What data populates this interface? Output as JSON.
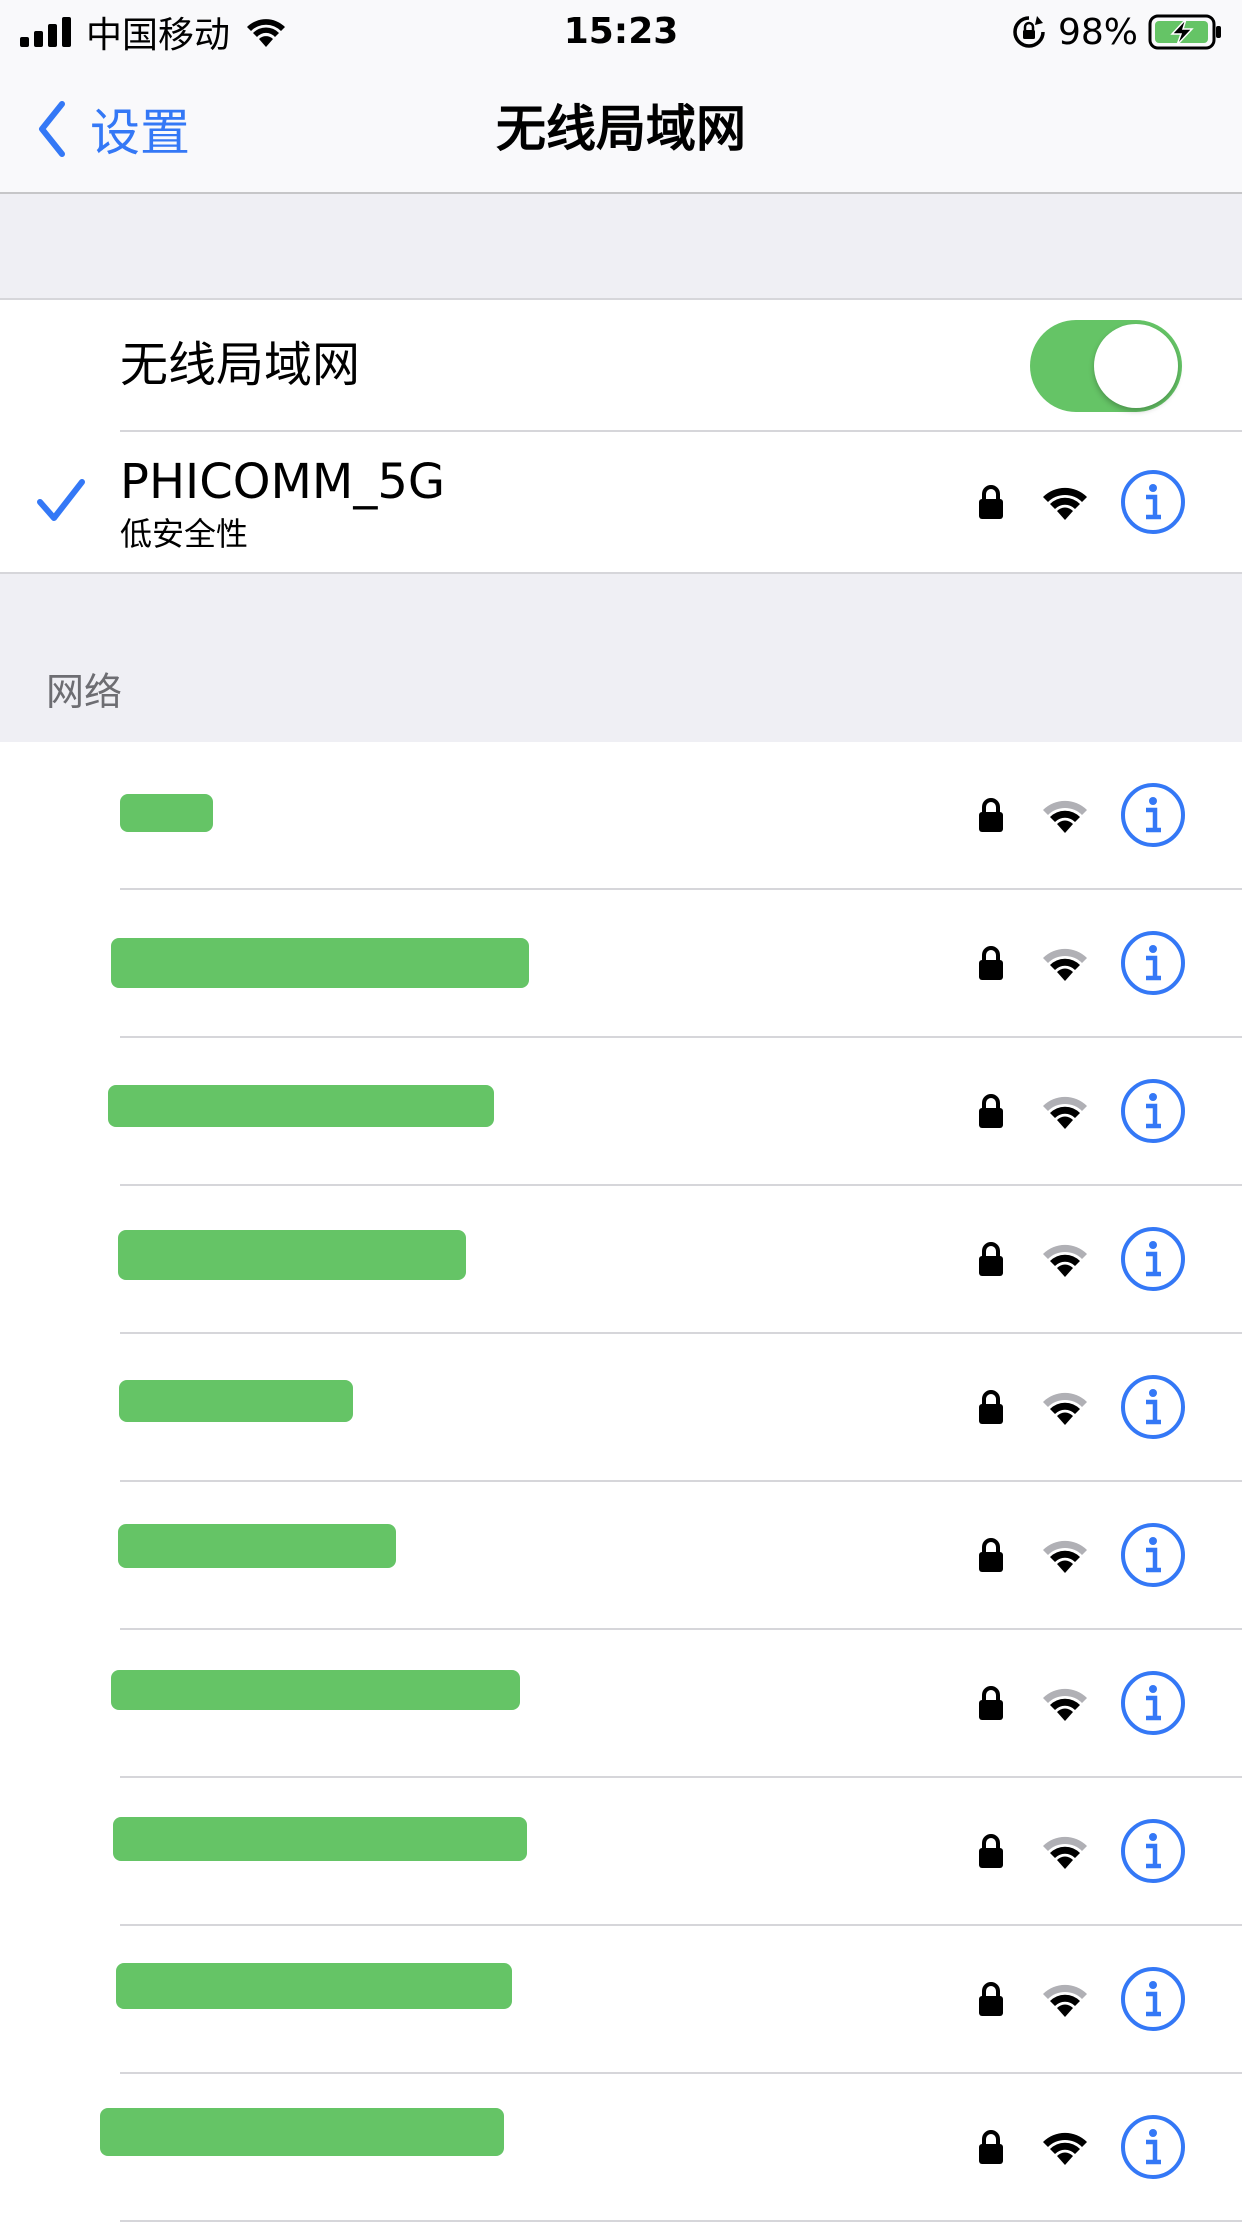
{
  "status_bar": {
    "carrier": "中国移动",
    "time": "15:23",
    "battery_percent": "98%",
    "battery_level": 0.98,
    "icons": [
      "cellular-signal-icon",
      "wifi-icon",
      "rotation-lock-icon",
      "battery-charging-icon"
    ]
  },
  "nav": {
    "back_label": "设置",
    "title": "无线局域网"
  },
  "wifi_toggle": {
    "label": "无线局域网",
    "on": true
  },
  "connected": {
    "name": "PHICOMM_5G",
    "subtitle": "低安全性",
    "secured": true,
    "signal": "full"
  },
  "networks_section": {
    "title": "网络"
  },
  "networks": [
    {
      "name_redacted": true,
      "secured": true,
      "signal": "weak"
    },
    {
      "name_redacted": true,
      "secured": true,
      "signal": "weak"
    },
    {
      "name_redacted": true,
      "secured": true,
      "signal": "weak"
    },
    {
      "name_redacted": true,
      "secured": true,
      "signal": "weak"
    },
    {
      "name_redacted": true,
      "secured": true,
      "signal": "weak"
    },
    {
      "name_redacted": true,
      "secured": true,
      "signal": "weak"
    },
    {
      "name_redacted": true,
      "secured": true,
      "signal": "weak"
    },
    {
      "name_redacted": true,
      "secured": true,
      "signal": "weak"
    },
    {
      "name_redacted": true,
      "secured": true,
      "signal": "weak"
    },
    {
      "name_redacted": true,
      "secured": true,
      "signal": "full"
    }
  ],
  "colors": {
    "accent": "#3478f6",
    "toggle_on": "#65c466",
    "group_background": "#efeff4",
    "redaction": "#65c466"
  }
}
